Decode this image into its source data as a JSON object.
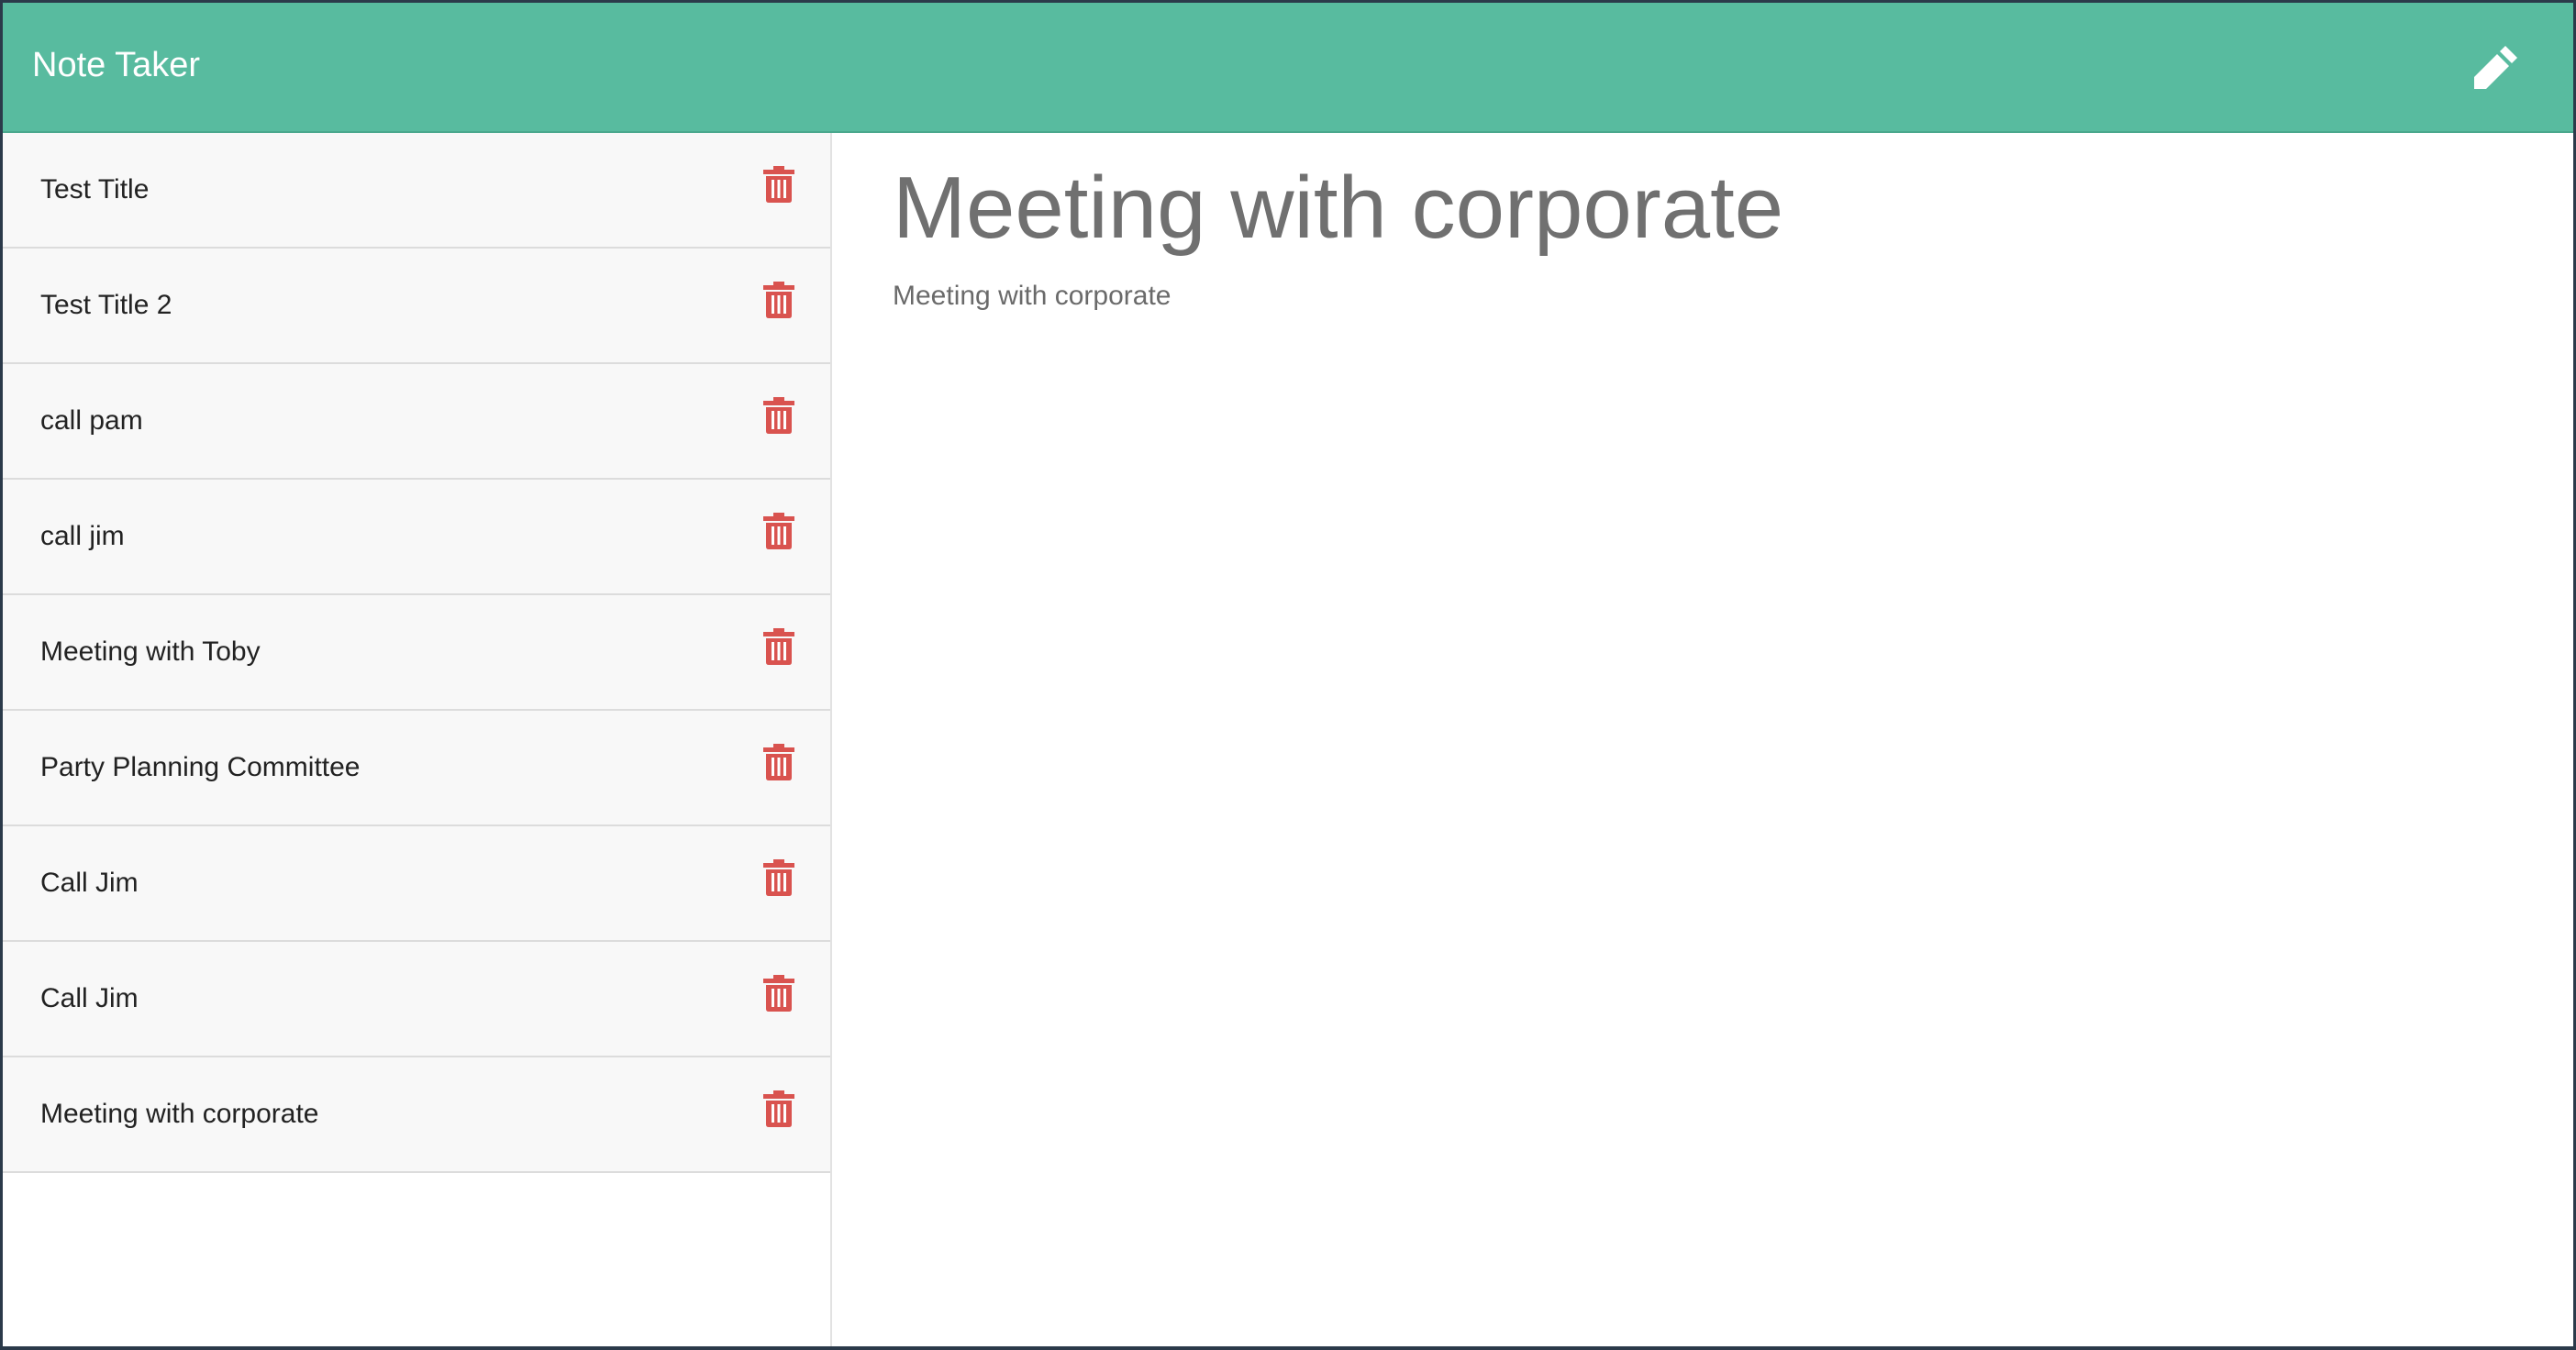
{
  "app": {
    "title": "Note Taker"
  },
  "icons": {
    "new_note": "pencil-icon",
    "delete": "trash-icon"
  },
  "colors": {
    "navbar": "#58bb9f",
    "delete_icon": "#d9534f",
    "heading_text": "#707070"
  },
  "notes": [
    {
      "title": "Test Title"
    },
    {
      "title": "Test Title 2"
    },
    {
      "title": "call pam"
    },
    {
      "title": "call jim"
    },
    {
      "title": "Meeting with Toby"
    },
    {
      "title": "Party Planning Committee"
    },
    {
      "title": "Call Jim"
    },
    {
      "title": "Call Jim"
    },
    {
      "title": "Meeting with corporate"
    }
  ],
  "active_note": {
    "title": "Meeting with corporate",
    "text": "Meeting with corporate"
  }
}
